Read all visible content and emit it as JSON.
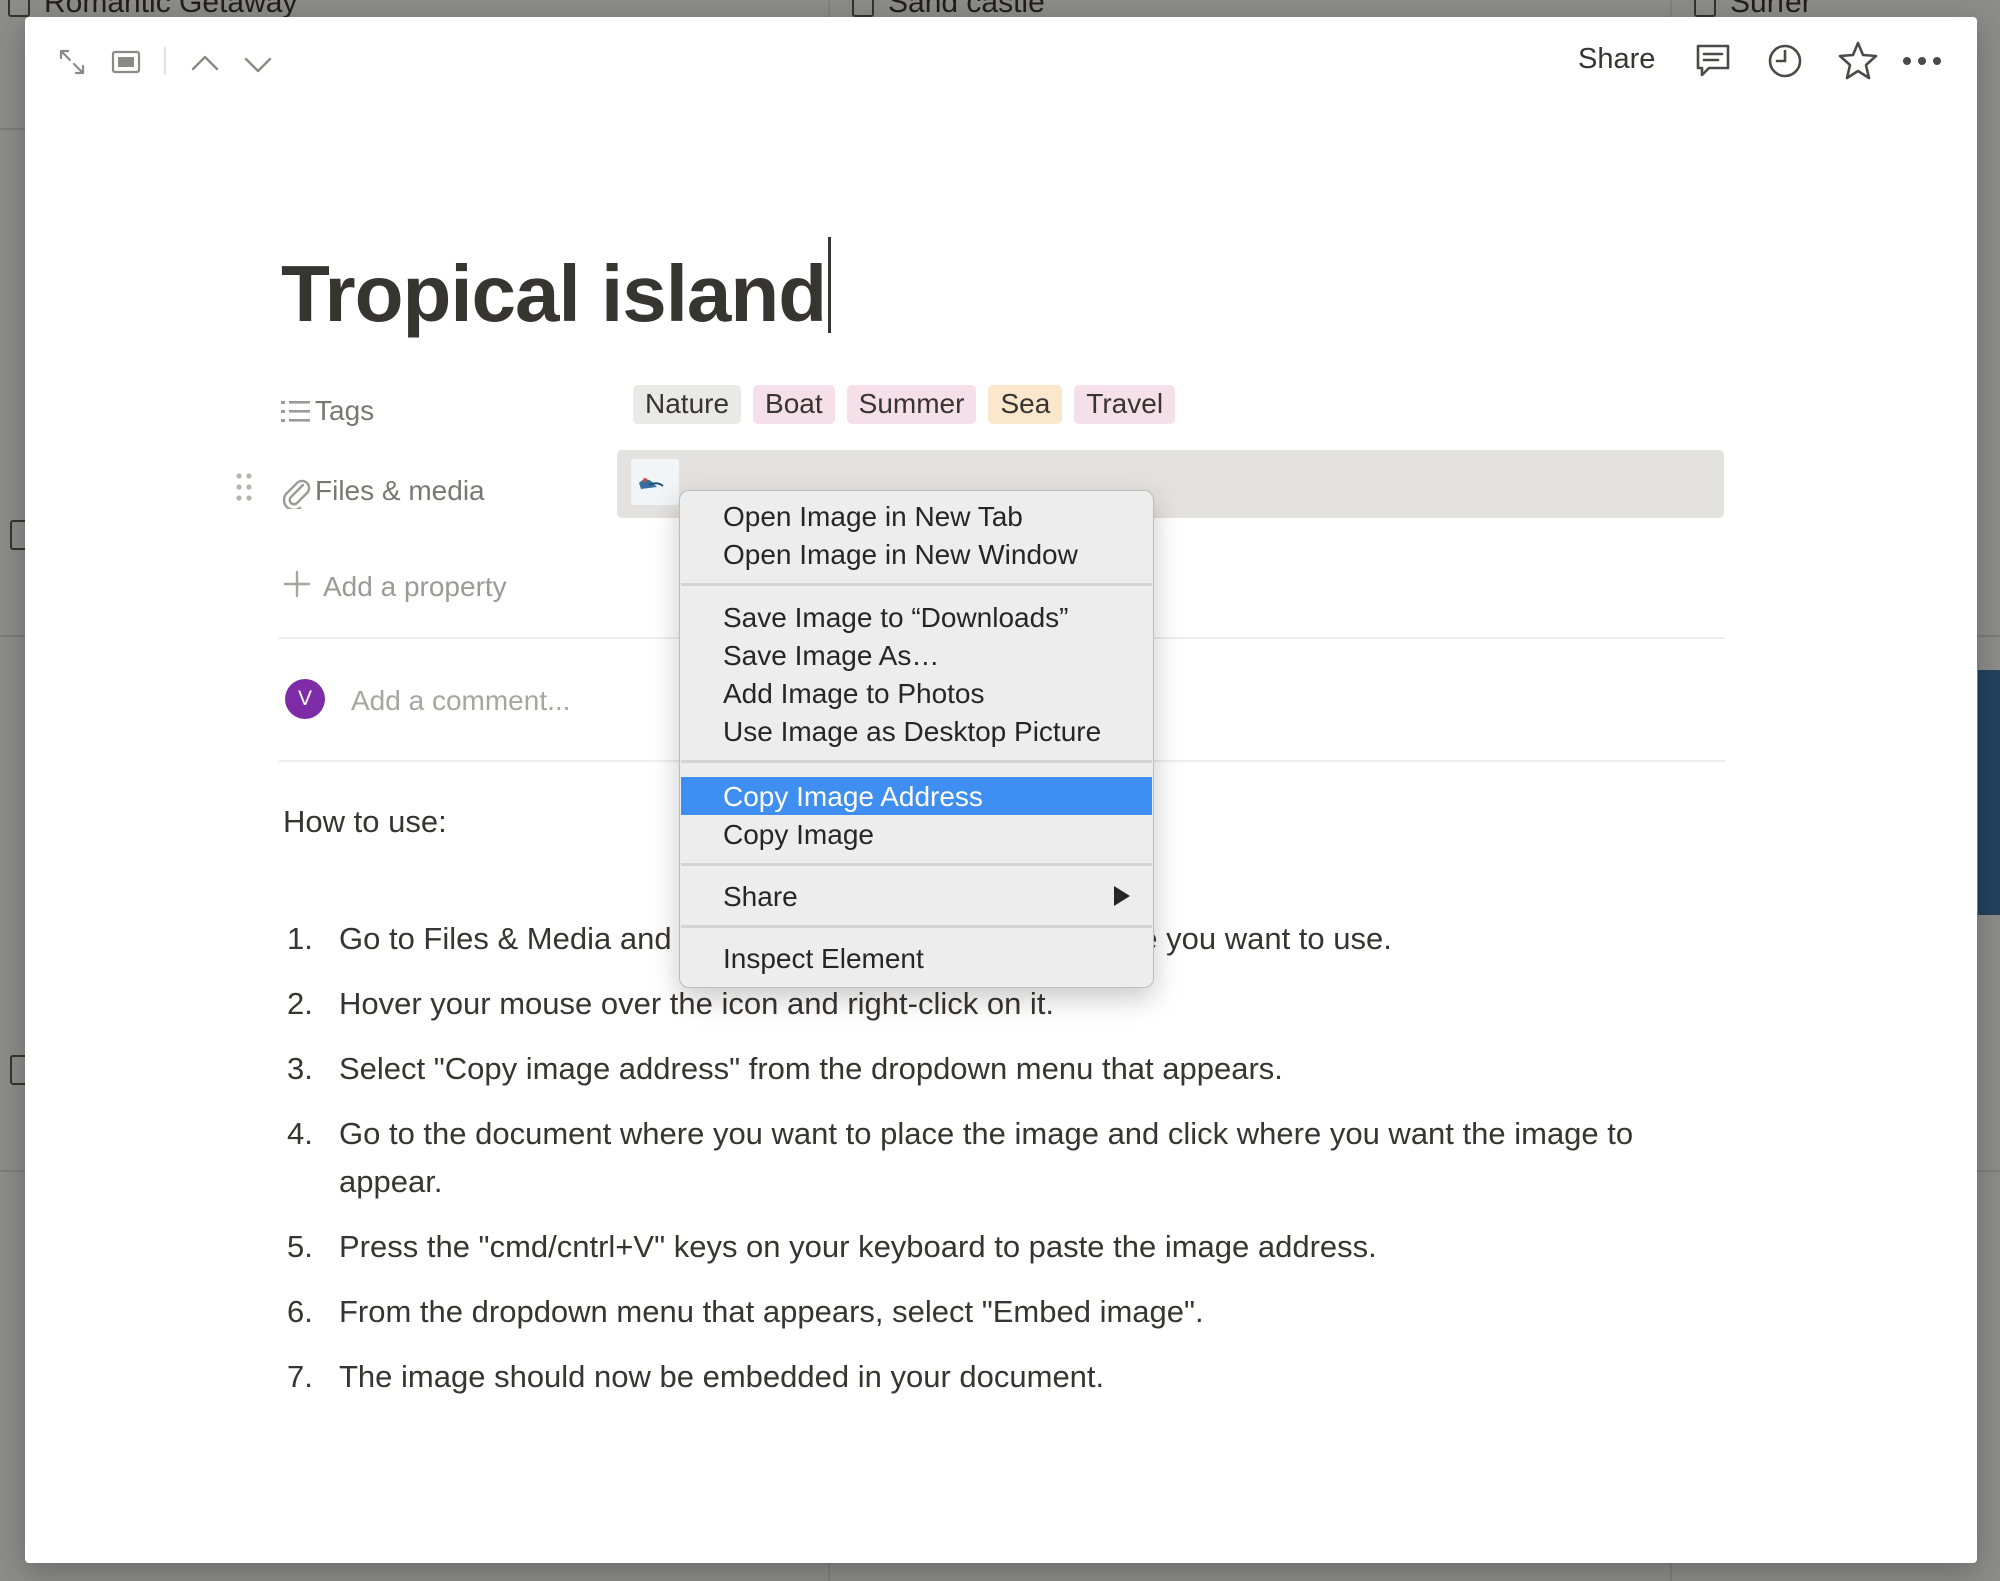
{
  "background_cards": [
    "Romantic Getaway",
    "Sand castle",
    "Surfer"
  ],
  "topbar": {
    "share_label": "Share"
  },
  "page": {
    "title": "Tropical island"
  },
  "properties": {
    "tags_label": "Tags",
    "tags": [
      {
        "label": "Nature",
        "color": "#e9e9e7"
      },
      {
        "label": "Boat",
        "color": "#f5e0e9"
      },
      {
        "label": "Summer",
        "color": "#f5e0e9"
      },
      {
        "label": "Sea",
        "color": "#fae7cc"
      },
      {
        "label": "Travel",
        "color": "#f5e0e9"
      }
    ],
    "files_label": "Files & media",
    "add_property_label": "Add a property"
  },
  "comment": {
    "avatar_initial": "V",
    "placeholder": "Add a comment..."
  },
  "content": {
    "heading": "How to use:",
    "steps": [
      "Go to Files & Media and click on the thumbnail of the image you want to use.",
      "Hover your mouse over the icon and right-click on it.",
      "Select \"Copy image address\" from the dropdown menu that appears.",
      "Go to the document where you want to place the image and click where you want the image to appear.",
      "Press the \"cmd/cntrl+V\" keys on your keyboard to paste the image address.",
      "From the dropdown menu that appears, select \"Embed image\".",
      "The image should now be embedded in your document."
    ]
  },
  "context_menu": {
    "items": [
      "Open Image in New Tab",
      "Open Image in New Window",
      "Save Image to “Downloads”",
      "Save Image As…",
      "Add Image to Photos",
      "Use Image as Desktop Picture",
      "Copy Image Address",
      "Copy Image",
      "Share",
      "Inspect Element"
    ],
    "highlighted": "Copy Image Address",
    "highlight_color": "#3f8ef2"
  }
}
